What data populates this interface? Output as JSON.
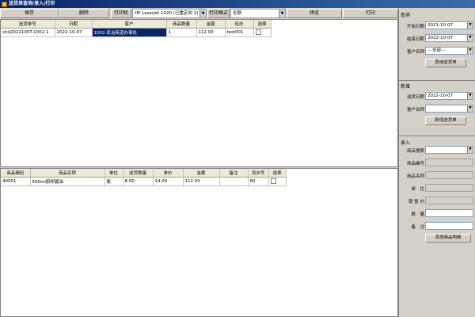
{
  "window": {
    "title": "送货单查询/录入/打印"
  },
  "toolbar": {
    "save_label": "保存",
    "delete_label": "删除",
    "printer_label": "打印机",
    "printer_value": "HP LaserJet 1020 (已重定向 2)",
    "print_format_label": "打印格式",
    "print_format_value": "全联",
    "preview_label": "预览",
    "print_label": "打印"
  },
  "orders": {
    "headers": [
      "送货单号",
      "日期",
      "客户",
      "商品数量",
      "金额",
      "经办",
      "选择"
    ],
    "rows": [
      {
        "no": "shd2022100T-1002-1",
        "date": "2022-10-07",
        "customer": "1002-民治街道办事处",
        "qty": "1",
        "amount": "112.00",
        "handler": "test001"
      }
    ]
  },
  "items": {
    "headers": [
      "商品编码",
      "商品名称",
      "单位",
      "送货数量",
      "单价",
      "金额",
      "备注",
      "流水号",
      "选择"
    ],
    "rows": [
      {
        "code": "40001",
        "name": "500ml厨邦酱油",
        "unit": "瓶",
        "qty": "8.00",
        "price": "14.00",
        "amount": "112.00",
        "note": "",
        "serial": "60"
      }
    ]
  },
  "query": {
    "title": "查询",
    "start_label": "开始日期",
    "start_value": "2021-10-07",
    "end_label": "结束日期",
    "end_value": "2022-10-07",
    "customer_label": "客户名称",
    "customer_value": "---全部---",
    "button": "查询送货单"
  },
  "new": {
    "title": "新增",
    "date_label": "送货日期",
    "date_value": "2022-10-07",
    "customer_label": "客户名称",
    "customer_value": "",
    "button": "新增送货单"
  },
  "entry": {
    "title": "录入",
    "search_label": "商品搜索",
    "code_label": "商品编号",
    "name_label": "商品名称",
    "unit_label": "单　位",
    "price_label": "销 售 价",
    "qty_label": "数　量",
    "note_label": "备　注",
    "button": "添加商品明细"
  }
}
